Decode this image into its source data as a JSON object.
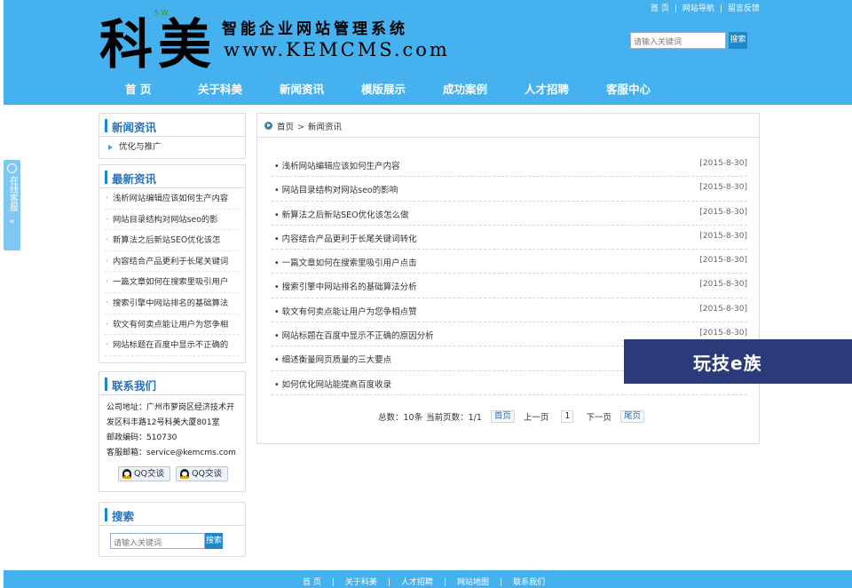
{
  "header": {
    "logo_big": "科美",
    "logo_mini": "S.W.",
    "slogan": "智能企业网站管理系统",
    "url": "www.KEMCMS.com",
    "top_links": [
      "首 页",
      "网站导航",
      "留言反馈"
    ],
    "search": {
      "placeholder": "请输入关键词",
      "button": "搜索"
    },
    "nav": [
      "首  页",
      "关于科美",
      "新闻资讯",
      "模版展示",
      "成功案例",
      "人才招聘",
      "客服中心"
    ]
  },
  "side_tab": {
    "text": "在线客服",
    "chevron": "«"
  },
  "sidebar": {
    "news_category": {
      "title": "新闻资讯",
      "items": [
        "优化与推广"
      ]
    },
    "latest": {
      "title": "最新资讯",
      "items": [
        "浅析网站编辑应该如何生产内容",
        "网站目录结构对网站seo的影",
        "新算法之后新站SEO优化该怎",
        "内容结合产品更利于长尾关键词",
        "一篇文章如何在搜索里吸引用户",
        "搜索引擎中网站排名的基础算法",
        "软文有何卖点能让用户为您争相",
        "网站标题在百度中显示不正确的"
      ]
    },
    "contact": {
      "title": "联系我们",
      "address": "公司地址：广州市萝岗区经济技术开发区科丰路12号科美大厦801室",
      "postcode": "邮政编码：510730",
      "email": "客服邮箱：service@kemcms.com",
      "qq_buttons": [
        "QQ交谈",
        "QQ交谈"
      ]
    },
    "search": {
      "title": "搜索",
      "placeholder": "请输入关键词",
      "button": "搜索"
    }
  },
  "main": {
    "breadcrumb": [
      "首页",
      "新闻资讯"
    ],
    "articles": [
      {
        "title": "浅析网站编辑应该如何生产内容",
        "date": "[2015-8-30]"
      },
      {
        "title": "网站目录结构对网站seo的影响",
        "date": "[2015-8-30]"
      },
      {
        "title": "新算法之后新站SEO优化该怎么做",
        "date": "[2015-8-30]"
      },
      {
        "title": "内容结合产品更利于长尾关键词转化",
        "date": "[2015-8-30]"
      },
      {
        "title": "一篇文章如何在搜索里吸引用户点击",
        "date": "[2015-8-30]"
      },
      {
        "title": "搜索引擎中网站排名的基础算法分析",
        "date": "[2015-8-30]"
      },
      {
        "title": "软文有何卖点能让用户为您争相点赞",
        "date": "[2015-8-30]"
      },
      {
        "title": "网站标题在百度中显示不正确的原因分析",
        "date": "[2015-8-30]"
      },
      {
        "title": "细述衡量网页质量的三大要点",
        "date": ""
      },
      {
        "title": "如何优化网站能提高百度收录",
        "date": ""
      }
    ],
    "pager": {
      "total": "总数：10条",
      "current": "当前页数：1/1",
      "first": "首页",
      "prev": "上一页",
      "page": "1",
      "next": "下一页",
      "last": "尾页"
    }
  },
  "watermark": "玩技e族",
  "footer": {
    "links": [
      "首 页",
      "关于科美",
      "人才招聘",
      "网站地图",
      "联系我们"
    ]
  }
}
